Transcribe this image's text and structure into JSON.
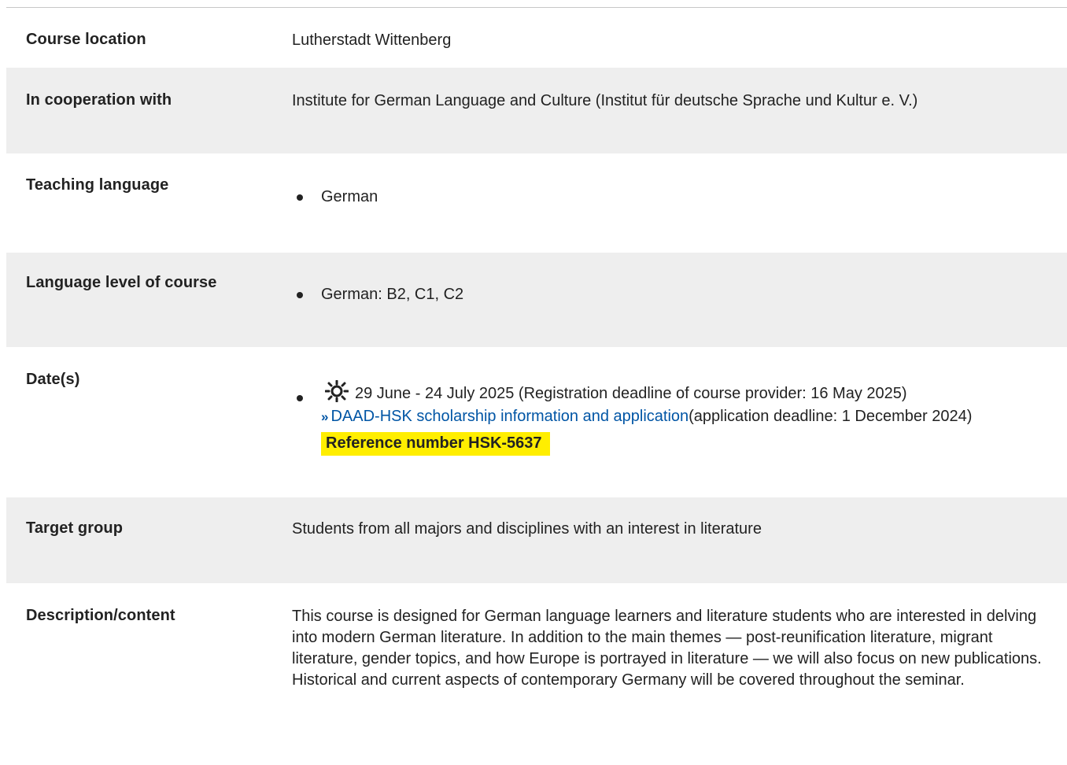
{
  "rows": {
    "course_location": {
      "label": "Course location",
      "value": "Lutherstadt Wittenberg"
    },
    "cooperation": {
      "label": "In cooperation with",
      "value": "Institute for German Language and Culture (Institut für deutsche Sprache und Kultur e. V.)"
    },
    "teaching_language": {
      "label": "Teaching language",
      "items": [
        "German"
      ]
    },
    "language_level": {
      "label": "Language level of course",
      "items": [
        "German: B2, C1, C2"
      ]
    },
    "dates": {
      "label": "Date(s)",
      "icon": "sun-icon",
      "date_text": "29 June - 24 July 2025 (Registration deadline of course provider: 16 May 2025)",
      "link_arrow": "»",
      "link_text": "DAAD-HSK scholarship information and application",
      "link_note": "(application deadline: 1 December 2024)",
      "reference": "Reference number HSK-5637"
    },
    "target_group": {
      "label": "Target group",
      "value": "Students from all majors and disciplines with an interest in literature"
    },
    "description": {
      "label": "Description/content",
      "value": "This course is designed for German language learners and literature students who are interested in delving into modern German literature. In addition to the main themes — post-reunification literature, migrant literature, gender topics, and how Europe is portrayed in literature — we will also focus on new publications. Historical and current aspects of contemporary Germany will be covered throughout the seminar."
    }
  },
  "colors": {
    "row_shade": "#eeeeee",
    "link": "#0055a5",
    "highlight": "#ffee00",
    "text": "#222222"
  }
}
